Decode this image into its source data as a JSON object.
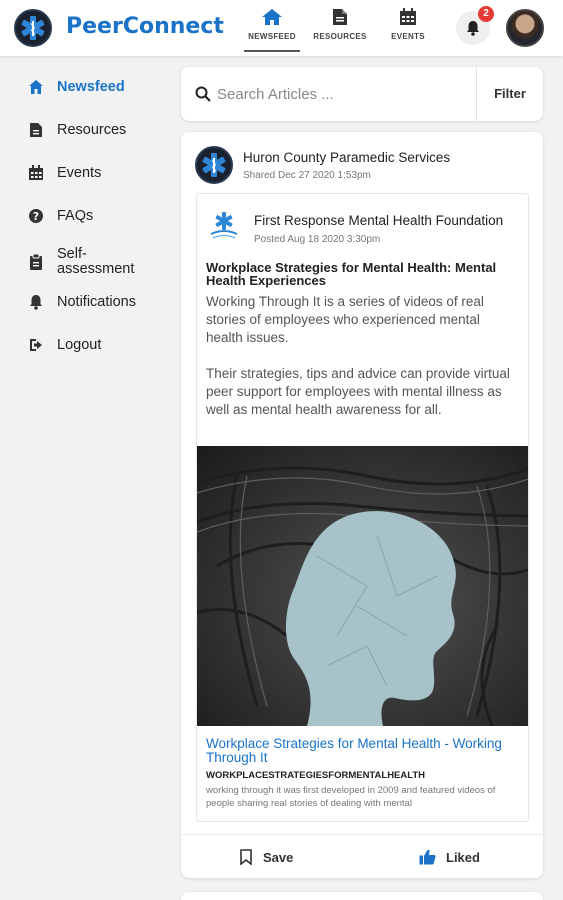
{
  "app": {
    "brand": "PeerConnect"
  },
  "nav": {
    "tabs": [
      {
        "label": "NEWSFEED",
        "icon": "home-icon"
      },
      {
        "label": "RESOURCES",
        "icon": "document-icon"
      },
      {
        "label": "EVENTS",
        "icon": "calendar-icon"
      }
    ],
    "notifications_count": "2"
  },
  "sidebar": {
    "items": [
      {
        "label": "Newsfeed",
        "icon": "home-icon"
      },
      {
        "label": "Resources",
        "icon": "document-icon"
      },
      {
        "label": "Events",
        "icon": "calendar-icon"
      },
      {
        "label": "FAQs",
        "icon": "question-icon"
      },
      {
        "label": "Self-\nassessment",
        "icon": "clipboard-icon"
      },
      {
        "label": "Notifications",
        "icon": "bell-icon"
      },
      {
        "label": "Logout",
        "icon": "logout-icon"
      }
    ]
  },
  "search": {
    "placeholder": "Search Articles ...",
    "filter_label": "Filter"
  },
  "post": {
    "author": "Huron County Paramedic Services",
    "meta": "Shared Dec 27 2020 1:53pm",
    "shared": {
      "org": "First Response Mental Health Foundation",
      "meta": "Posted Aug 18 2020 3:30pm",
      "title": "Workplace Strategies for Mental Health: Mental Health Experiences",
      "body_1": "Working Through It is a series of videos of real stories of employees who experienced mental health issues.",
      "body_2": "Their strategies, tips and advice can provide virtual peer support for employees with mental illness as well as mental health awareness for all.",
      "link_title": "Workplace Strategies for Mental Health - Working Through It",
      "link_domain": "WORKPLACESTRATEGIESFORMENTALHEALTH",
      "link_desc": "working through it was first developed in 2009 and featured videos of people sharing real stories of dealing with mental"
    },
    "actions": {
      "save": "Save",
      "like": "Liked"
    }
  },
  "colors": {
    "accent": "#1a73c8",
    "badge": "#e53935"
  }
}
